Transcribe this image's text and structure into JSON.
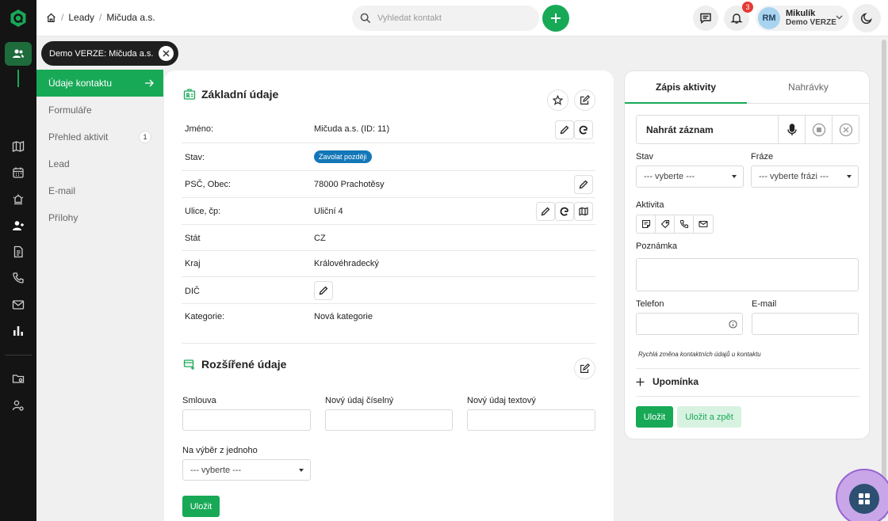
{
  "breadcrumb": {
    "section": "Leady",
    "current": "Mičuda a.s."
  },
  "search": {
    "placeholder": "Vyhledat kontakt"
  },
  "notifications": {
    "count": "3"
  },
  "user": {
    "initials": "RM",
    "name": "Mikulík",
    "company": "Demo VERZE"
  },
  "chip": {
    "label": "Demo VERZE: Mičuda a.s."
  },
  "sidenav": {
    "items": [
      {
        "label": "Údaje kontaktu"
      },
      {
        "label": "Formuláře"
      },
      {
        "label": "Přehled aktivit",
        "count": "1"
      },
      {
        "label": "Lead"
      },
      {
        "label": "E-mail"
      },
      {
        "label": "Přílohy"
      }
    ]
  },
  "basic": {
    "title": "Základní údaje",
    "fields": [
      {
        "label": "Jméno:",
        "value": "Mičuda a.s. (ID: 11)"
      },
      {
        "label": "Stav:",
        "value": "Zavolat později"
      },
      {
        "label": "PSČ, Obec:",
        "value": "78000 Prachotěsy"
      },
      {
        "label": "Ulice, čp:",
        "value": "Uliční 4"
      },
      {
        "label": "Stát",
        "value": "CZ"
      },
      {
        "label": "Kraj",
        "value": "Královéhradecký"
      },
      {
        "label": "DIČ",
        "value": ""
      },
      {
        "label": "Kategorie:",
        "value": "Nová kategorie"
      }
    ]
  },
  "extended": {
    "title": "Rozšířené údaje",
    "smlouva": "Smlouva",
    "cislo": "Nový údaj číselný",
    "text": "Nový údaj textový",
    "vyber": "Na výběr z jednoho",
    "vyber_value": "--- vyberte ---",
    "save": "Uložit"
  },
  "panel": {
    "tab_active": "Zápis aktivity",
    "tab_other": "Nahrávky",
    "record": "Nahrát záznam",
    "stav_label": "Stav",
    "stav_value": "--- vyberte ---",
    "fraze_label": "Fráze",
    "fraze_value": "--- vyberte frázi ---",
    "aktivita_label": "Aktivita",
    "poznamka_label": "Poznámka",
    "telefon_label": "Telefon",
    "email_label": "E-mail",
    "hint": "Rychlá změna kontaktních údajů u kontaktu",
    "upominka": "Upomínka",
    "save": "Uložit",
    "save_back": "Uložit a zpět"
  },
  "colors": {
    "brand": "#18a957",
    "status_pill": "#1377b8",
    "rail": "#141414"
  }
}
